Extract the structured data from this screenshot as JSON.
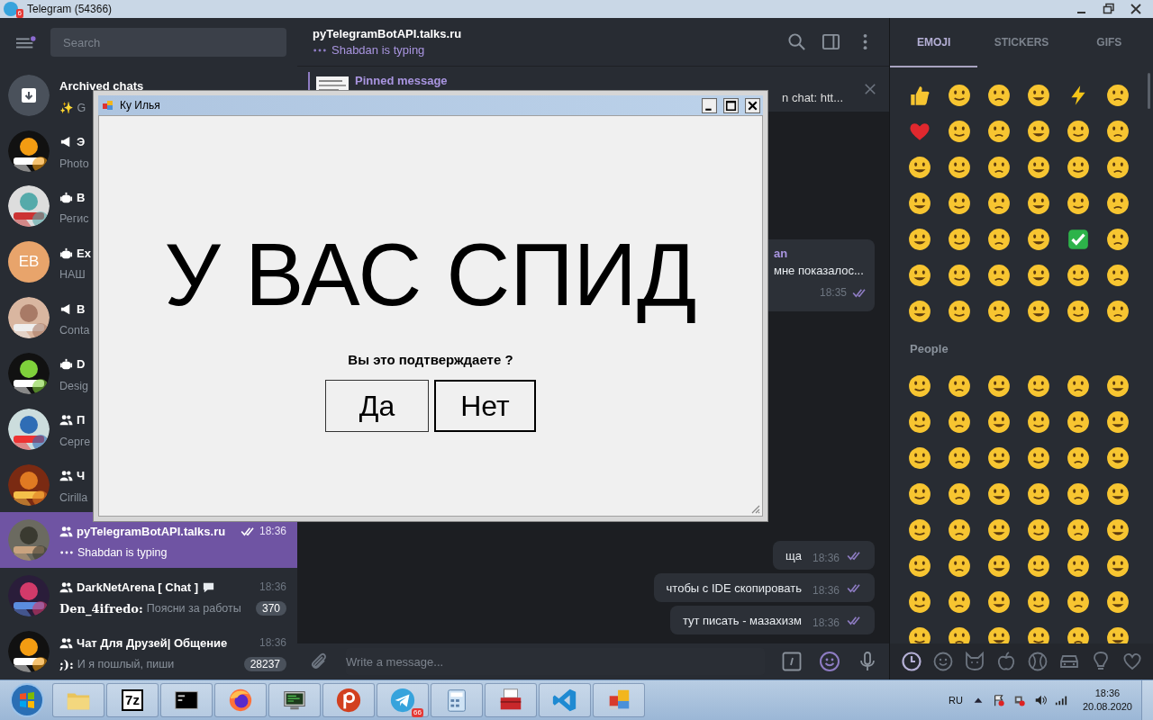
{
  "window": {
    "title": "Telegram (54366)",
    "badge": "6"
  },
  "sidebar": {
    "menu_has_dot": true,
    "search": {
      "placeholder": "Search"
    },
    "chats": [
      {
        "kind": "archive",
        "name": "Archived chats",
        "preview": "✨ G",
        "selected": false
      },
      {
        "kind": "channel",
        "name": "Э",
        "preview": "Photo",
        "selected": false
      },
      {
        "kind": "broadcast",
        "name": "В",
        "preview": "Регис",
        "selected": false
      },
      {
        "kind": "broadcast",
        "avatar": {
          "kind": "initials",
          "text": "EB",
          "color": "#e8a46b"
        },
        "name": "Ex",
        "preview": "НАШ",
        "selected": false
      },
      {
        "kind": "channel",
        "name": "В",
        "preview": "Conta",
        "selected": false
      },
      {
        "kind": "broadcast",
        "name": "D",
        "preview": "Desig",
        "selected": false
      },
      {
        "kind": "group",
        "name": "П",
        "preview": "Серге",
        "selected": false
      },
      {
        "kind": "group",
        "name": "Ч",
        "preview": "Cirilla",
        "selected": false
      },
      {
        "kind": "group",
        "name": "pyTelegramBotAPI.talks.ru",
        "time": "18:36",
        "read": true,
        "typing": true,
        "preview": "Shabdan is typing",
        "selected": true
      },
      {
        "kind": "group",
        "name": "DarkNetArena [ Chat ]",
        "name_bubble": true,
        "time": "18:36",
        "sender": "Den_4ifredo:",
        "preview": "Поясни за работы",
        "unread": "370",
        "selected": false
      },
      {
        "kind": "group",
        "name": "Чат Для Друзей| Общение",
        "time": "18:36",
        "sender": ";):",
        "preview": "И я пошлый, пиши",
        "unread": "28237",
        "selected": false
      }
    ]
  },
  "chat": {
    "title": "pyTelegramBotAPI.talks.ru",
    "typing": true,
    "status": "Shabdan is typing",
    "pinned": {
      "label": "Pinned message",
      "text": "n chat: htt..."
    },
    "messages": [
      {
        "sender": "an",
        "text": "мне показалос...",
        "time": "18:35",
        "read": true
      },
      {
        "text": "ща",
        "time": "18:36",
        "read": true
      },
      {
        "text": "чтобы с IDE скопировать",
        "time": "18:36",
        "read": true
      },
      {
        "text": "тут писать - мазахизм",
        "time": "18:36",
        "read": true
      }
    ],
    "composer": {
      "placeholder": "Write a message..."
    }
  },
  "emoji_panel": {
    "tabs": [
      {
        "label": "EMOJI",
        "selected": true
      },
      {
        "label": "STICKERS",
        "selected": false
      },
      {
        "label": "GIFS",
        "selected": false
      }
    ],
    "section": "People",
    "categories": [
      {
        "kind": "recent",
        "selected": true
      },
      {
        "kind": "people",
        "selected": false
      },
      {
        "kind": "animals",
        "selected": false
      },
      {
        "kind": "food",
        "selected": false
      },
      {
        "kind": "activity",
        "selected": false
      },
      {
        "kind": "travel",
        "selected": false
      },
      {
        "kind": "objects",
        "selected": false
      },
      {
        "kind": "symbols",
        "selected": false
      }
    ]
  },
  "dialog": {
    "title": "Ку Илья",
    "headline": "У ВАС СПИД",
    "question": "Вы это подтверждаете ?",
    "buttons": [
      {
        "label": "Да",
        "focused": false
      },
      {
        "label": "Нет",
        "focused": true
      }
    ]
  },
  "taskbar": {
    "apps": [
      {
        "kind": "explorer"
      },
      {
        "kind": "archiver",
        "label": "7z"
      },
      {
        "kind": "console"
      },
      {
        "kind": "firefox"
      },
      {
        "kind": "terminal"
      },
      {
        "kind": "psiphon"
      },
      {
        "kind": "telegram",
        "badge": "66"
      },
      {
        "kind": "calculator"
      },
      {
        "kind": "toolbox"
      },
      {
        "kind": "vscode"
      },
      {
        "kind": "app"
      }
    ],
    "language": "RU",
    "time": "18:36",
    "date": "20.08.2020"
  }
}
